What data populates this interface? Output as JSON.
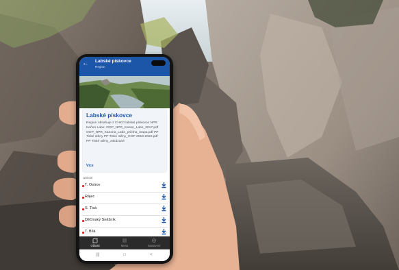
{
  "app": {
    "title": "Labské pískovce",
    "subtitle": "Region"
  },
  "card": {
    "title": "Labské pískovce",
    "text": "Region obsahuje z CHKO labské pískovce NPR Kaňon Labe; OOP_NPR_Kanon_Labe_2017.pdf OOP_NPR_Kanona_Labe_priloha_mapa.pdf PP Tiské stěny PP Tiské stěny_OOP 2018-2022.pdf PP Tiské stěny_zakázané",
    "more": "Více"
  },
  "list": {
    "header": "Oblasti",
    "items": [
      {
        "label": "T. Ostrov"
      },
      {
        "label": "Rájec"
      },
      {
        "label": "S. Tisá"
      },
      {
        "label": "Děčínský Sněžník"
      },
      {
        "label": "T. Bílá"
      }
    ]
  },
  "bottom_nav": [
    {
      "label": "Oblasti",
      "icon": "map-icon"
    },
    {
      "label": "Menu",
      "icon": "menu-icon"
    },
    {
      "label": "Nastavení",
      "icon": "gear-icon"
    }
  ],
  "system_nav": [
    "recents-icon",
    "home-icon",
    "back-icon"
  ],
  "colors": {
    "accent": "#1c56a8",
    "pin": "#d22222",
    "nav_bg": "#2b2b2b",
    "rock": "#8f857c"
  }
}
